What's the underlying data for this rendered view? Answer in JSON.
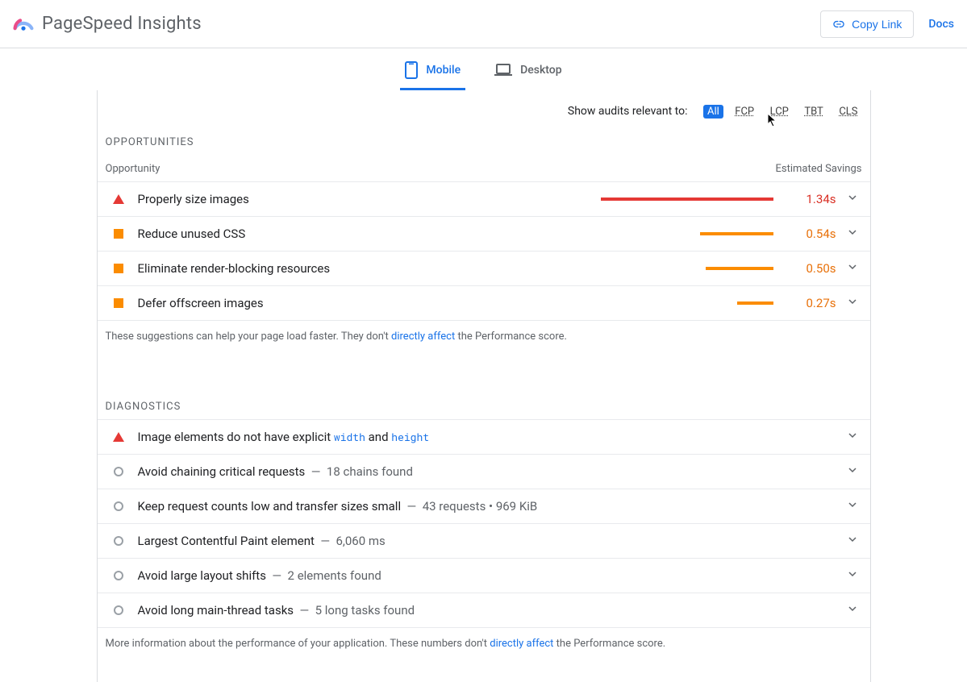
{
  "header": {
    "title": "PageSpeed Insights",
    "copy_link_label": "Copy Link",
    "docs_label": "Docs"
  },
  "tabs": {
    "mobile": "Mobile",
    "desktop": "Desktop"
  },
  "filters": {
    "label": "Show audits relevant to:",
    "all": "All",
    "fcp": "FCP",
    "lcp": "LCP",
    "tbt": "TBT",
    "cls": "CLS"
  },
  "opportunities": {
    "heading": "OPPORTUNITIES",
    "col_opportunity": "Opportunity",
    "col_savings": "Estimated Savings",
    "items": [
      {
        "title": "Properly size images",
        "savings": "1.34s",
        "severity": "red",
        "bar_pct": 82
      },
      {
        "title": "Reduce unused CSS",
        "savings": "0.54s",
        "severity": "orange",
        "bar_pct": 35
      },
      {
        "title": "Eliminate render-blocking resources",
        "savings": "0.50s",
        "severity": "orange",
        "bar_pct": 32
      },
      {
        "title": "Defer offscreen images",
        "savings": "0.27s",
        "severity": "orange",
        "bar_pct": 17
      }
    ],
    "footer_prefix": "These suggestions can help your page load faster. They don't ",
    "footer_link": "directly affect",
    "footer_suffix": " the Performance score."
  },
  "diagnostics": {
    "heading": "DIAGNOSTICS",
    "items": [
      {
        "severity": "red",
        "pre": "Image elements do not have explicit ",
        "code1": "width",
        "mid": " and ",
        "code2": "height",
        "suffix": ""
      },
      {
        "severity": "gray",
        "pre": "Avoid chaining critical requests",
        "suffix": "18 chains found"
      },
      {
        "severity": "gray",
        "pre": "Keep request counts low and transfer sizes small",
        "suffix": "43 requests • 969 KiB"
      },
      {
        "severity": "gray",
        "pre": "Largest Contentful Paint element",
        "suffix": "6,060 ms"
      },
      {
        "severity": "gray",
        "pre": "Avoid large layout shifts",
        "suffix": "2 elements found"
      },
      {
        "severity": "gray",
        "pre": "Avoid long main-thread tasks",
        "suffix": "5 long tasks found"
      }
    ],
    "footer_prefix": "More information about the performance of your application. These numbers don't ",
    "footer_link": "directly affect",
    "footer_suffix": " the Performance score."
  }
}
